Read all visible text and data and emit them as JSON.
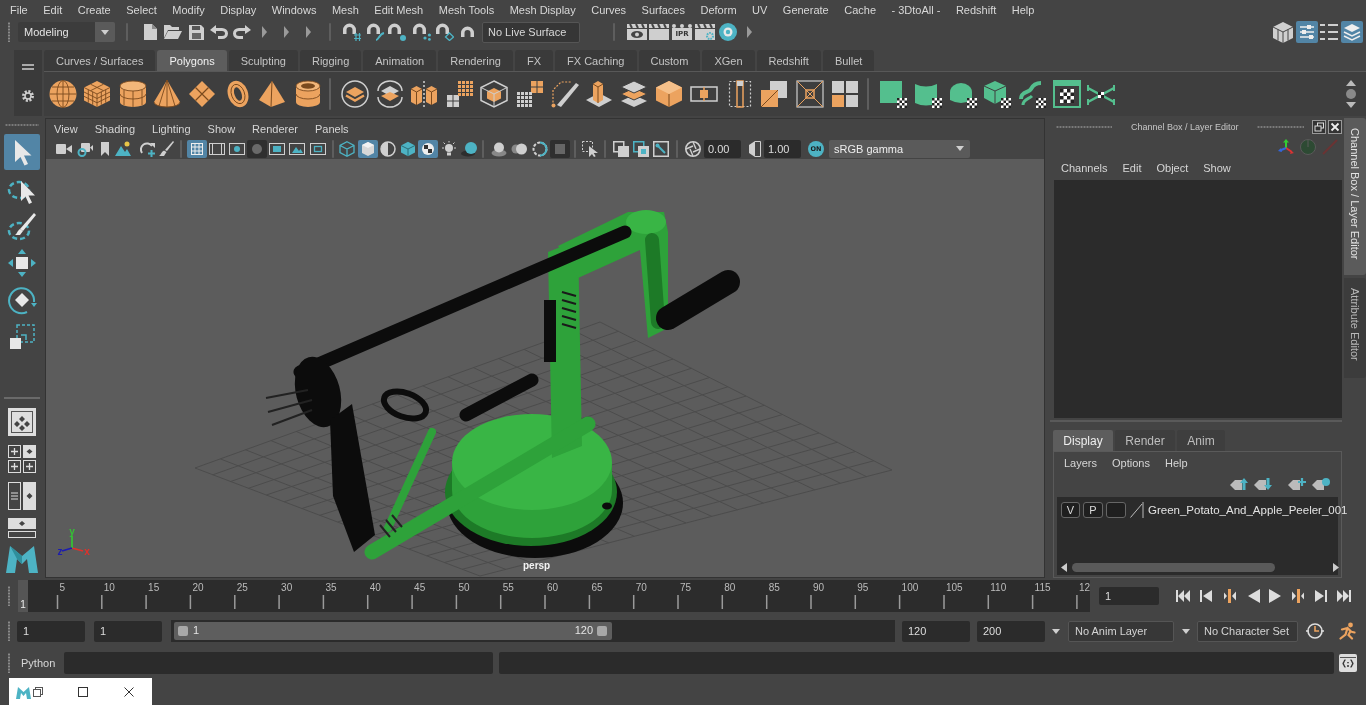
{
  "menu_bar": [
    "File",
    "Edit",
    "Create",
    "Select",
    "Modify",
    "Display",
    "Windows",
    "Mesh",
    "Edit Mesh",
    "Mesh Tools",
    "Mesh Display",
    "Curves",
    "Surfaces",
    "Deform",
    "UV",
    "Generate",
    "Cache",
    "- 3DtoAll -",
    "Redshift",
    "Help"
  ],
  "status_line": {
    "menu_set": "Modeling",
    "live_surface": "No Live Surface",
    "ipr_label": "IPR"
  },
  "shelf": {
    "tabs": [
      {
        "label": "Curves / Surfaces",
        "selected": false
      },
      {
        "label": "Polygons",
        "selected": true
      },
      {
        "label": "Sculpting",
        "selected": false
      },
      {
        "label": "Rigging",
        "selected": false
      },
      {
        "label": "Animation",
        "selected": false
      },
      {
        "label": "Rendering",
        "selected": false
      },
      {
        "label": "FX",
        "selected": false
      },
      {
        "label": "FX Caching",
        "selected": false
      },
      {
        "label": "Custom",
        "selected": false
      },
      {
        "label": "XGen",
        "selected": false
      },
      {
        "label": "Redshift",
        "selected": false
      },
      {
        "label": "Bullet",
        "selected": false
      }
    ]
  },
  "viewport": {
    "menus": [
      "View",
      "Shading",
      "Lighting",
      "Show",
      "Renderer",
      "Panels"
    ],
    "exposure": "0.00",
    "gamma": "1.00",
    "view_transform": "ON",
    "color_space": "sRGB gamma",
    "camera": "persp",
    "axes": [
      {
        "label": "x",
        "color": "#e0312b"
      },
      {
        "label": "y",
        "color": "#35c035"
      },
      {
        "label": "z",
        "color": "#1c1cb0"
      }
    ]
  },
  "channel_box": {
    "title": "Channel Box / Layer Editor",
    "menus": [
      "Channels",
      "Edit",
      "Object",
      "Show"
    ]
  },
  "layer_editor": {
    "tabs": [
      {
        "label": "Display",
        "selected": true
      },
      {
        "label": "Render",
        "selected": false
      },
      {
        "label": "Anim",
        "selected": false
      }
    ],
    "menus": [
      "Layers",
      "Options",
      "Help"
    ],
    "layers": [
      {
        "visibility": "V",
        "playback": "P",
        "name": "Green_Potato_And_Apple_Peeler_001"
      }
    ]
  },
  "side_tabs": [
    {
      "label": "Channel Box / Layer Editor",
      "selected": true
    },
    {
      "label": "Attribute Editor",
      "selected": false
    }
  ],
  "time_slider": {
    "frame_labels": [
      "5",
      "10",
      "15",
      "20",
      "25",
      "30",
      "35",
      "40",
      "45",
      "50",
      "55",
      "60",
      "65",
      "70",
      "75",
      "80",
      "85",
      "90",
      "95",
      "100",
      "105",
      "110",
      "115",
      "12"
    ],
    "level": 0,
    "current_frame_marker": "1",
    "current_frame": "1"
  },
  "range_slider": {
    "animation_start": "1",
    "playback_start": "1",
    "level": 0.61,
    "range_start": "1",
    "range_end": "120",
    "playback_end": "120",
    "animation_end": "200",
    "anim_layer": "No Anim Layer",
    "character_set": "No Character Set"
  },
  "command_line": {
    "language": "Python"
  }
}
